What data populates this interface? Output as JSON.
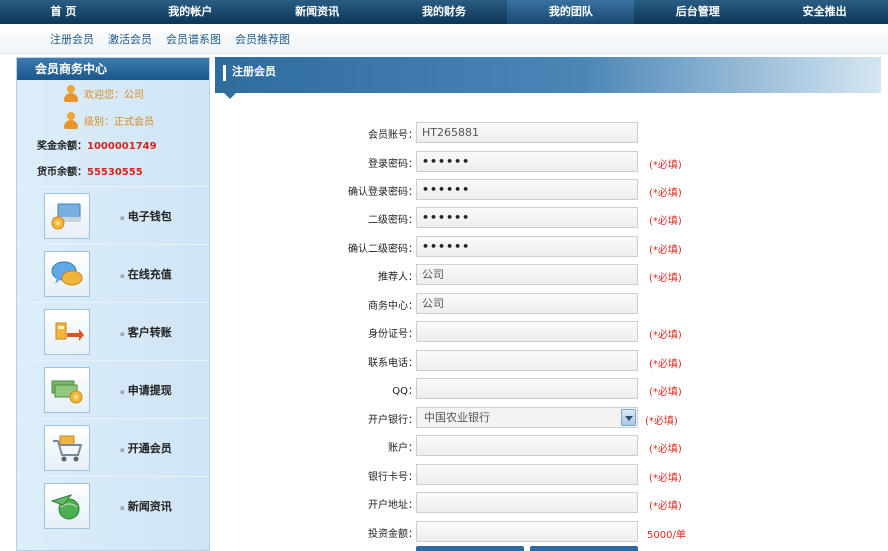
{
  "topnav": {
    "items": [
      "首 页",
      "我的帐户",
      "新闻资讯",
      "我的财务",
      "我的团队",
      "后台管理",
      "安全推出"
    ],
    "active_index": 4
  },
  "subnav": {
    "items": [
      "注册会员",
      "激活会员",
      "会员谱系图",
      "会员推荐图"
    ]
  },
  "sidebar": {
    "title": "会员商务中心",
    "welcome": "欢迎您：公司",
    "level": "级别：正式会员",
    "bonus_label": "奖金余额：",
    "bonus_value": "1000001749",
    "currency_label": "货币余额：",
    "currency_value": "55530555",
    "menu": [
      "电子钱包",
      "在线充值",
      "客户转账",
      "申请提现",
      "开通会员",
      "新闻资讯"
    ]
  },
  "main": {
    "title": "注册会员",
    "required_text": "(*必填)",
    "invest_note": "5000/单",
    "fields": [
      {
        "label": "会员账号：",
        "value": "HT265881",
        "type": "text",
        "required": false
      },
      {
        "label": "登录密码：",
        "value": "••••••",
        "type": "password",
        "required": true
      },
      {
        "label": "确认登录密码：",
        "value": "••••••",
        "type": "password",
        "required": true
      },
      {
        "label": "二级密码：",
        "value": "••••••",
        "type": "password",
        "required": true
      },
      {
        "label": "确认二级密码：",
        "value": "••••••",
        "type": "password",
        "required": true
      },
      {
        "label": "推荐人：",
        "value": "公司",
        "type": "text",
        "required": true
      },
      {
        "label": "商务中心：",
        "value": "公司",
        "type": "text",
        "required": false
      },
      {
        "label": "身份证号：",
        "value": "",
        "type": "text",
        "required": true
      },
      {
        "label": "联系电话：",
        "value": "",
        "type": "text",
        "required": true
      },
      {
        "label": "QQ：",
        "value": "",
        "type": "text",
        "required": true
      },
      {
        "label": "开户银行：",
        "value": "中国农业银行",
        "type": "select",
        "required": true
      },
      {
        "label": "账户：",
        "value": "",
        "type": "text",
        "required": true
      },
      {
        "label": "银行卡号：",
        "value": "",
        "type": "text",
        "required": true
      },
      {
        "label": "开户地址：",
        "value": "",
        "type": "text",
        "required": true
      },
      {
        "label": "投资金额：",
        "value": "",
        "type": "text",
        "required": false
      }
    ]
  }
}
